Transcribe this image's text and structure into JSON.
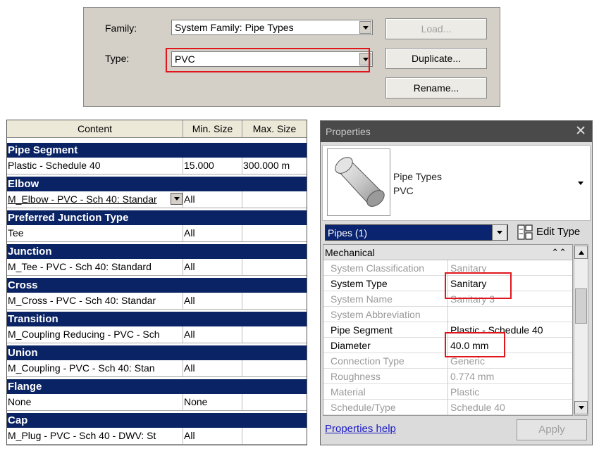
{
  "type_dialog": {
    "family_label": "Family:",
    "family_value": "System Family: Pipe Types",
    "type_label": "Type:",
    "type_value": "PVC",
    "load_label": "Load...",
    "duplicate_label": "Duplicate...",
    "rename_label": "Rename..."
  },
  "routing_table": {
    "headers": [
      "Content",
      "Min. Size",
      "Max. Size"
    ],
    "groups": [
      {
        "title": "Pipe Segment",
        "row": [
          "Plastic - Schedule 40",
          "15.000",
          "300.000 m"
        ]
      },
      {
        "title": "Elbow",
        "row": [
          "M_Elbow - PVC - Sch 40: Standar",
          "All",
          ""
        ]
      },
      {
        "title": "Preferred Junction Type",
        "row": [
          "Tee",
          "All",
          ""
        ]
      },
      {
        "title": "Junction",
        "row": [
          "M_Tee - PVC - Sch 40: Standard",
          "All",
          ""
        ]
      },
      {
        "title": "Cross",
        "row": [
          "M_Cross - PVC - Sch 40: Standar",
          "All",
          ""
        ]
      },
      {
        "title": "Transition",
        "row": [
          "M_Coupling Reducing - PVC - Sch",
          "All",
          ""
        ]
      },
      {
        "title": "Union",
        "row": [
          "M_Coupling - PVC - Sch 40: Stan",
          "All",
          ""
        ]
      },
      {
        "title": "Flange",
        "row": [
          "None",
          "None",
          ""
        ]
      },
      {
        "title": "Cap",
        "row": [
          "M_Plug - PVC - Sch 40 - DWV: St",
          "All",
          ""
        ]
      }
    ]
  },
  "properties": {
    "title": "Properties",
    "close_glyph": "✕",
    "type_name_1": "Pipe Types",
    "type_name_2": "PVC",
    "instance_selector": "Pipes (1)",
    "edit_type_label": "Edit Type",
    "section": "Mechanical",
    "rows": [
      {
        "name": "System Classification",
        "value": "Sanitary",
        "disabled": true
      },
      {
        "name": "System Type",
        "value": "Sanitary",
        "disabled": false
      },
      {
        "name": "System Name",
        "value": "Sanitary 3",
        "disabled": true
      },
      {
        "name": "System Abbreviation",
        "value": "",
        "disabled": true
      },
      {
        "name": "Pipe Segment",
        "value": "Plastic - Schedule 40",
        "disabled": false
      },
      {
        "name": "Diameter",
        "value": "40.0 mm",
        "disabled": false
      },
      {
        "name": "Connection Type",
        "value": "Generic",
        "disabled": true
      },
      {
        "name": "Roughness",
        "value": "0.774 mm",
        "disabled": true
      },
      {
        "name": "Material",
        "value": "Plastic",
        "disabled": true
      },
      {
        "name": "Schedule/Type",
        "value": "Schedule 40",
        "disabled": true
      }
    ],
    "help_link": "Properties help",
    "apply_label": "Apply"
  },
  "colors": {
    "highlight": "#e0161c",
    "group_header": "#0a2364",
    "titlebar": "#4a4a4a"
  }
}
